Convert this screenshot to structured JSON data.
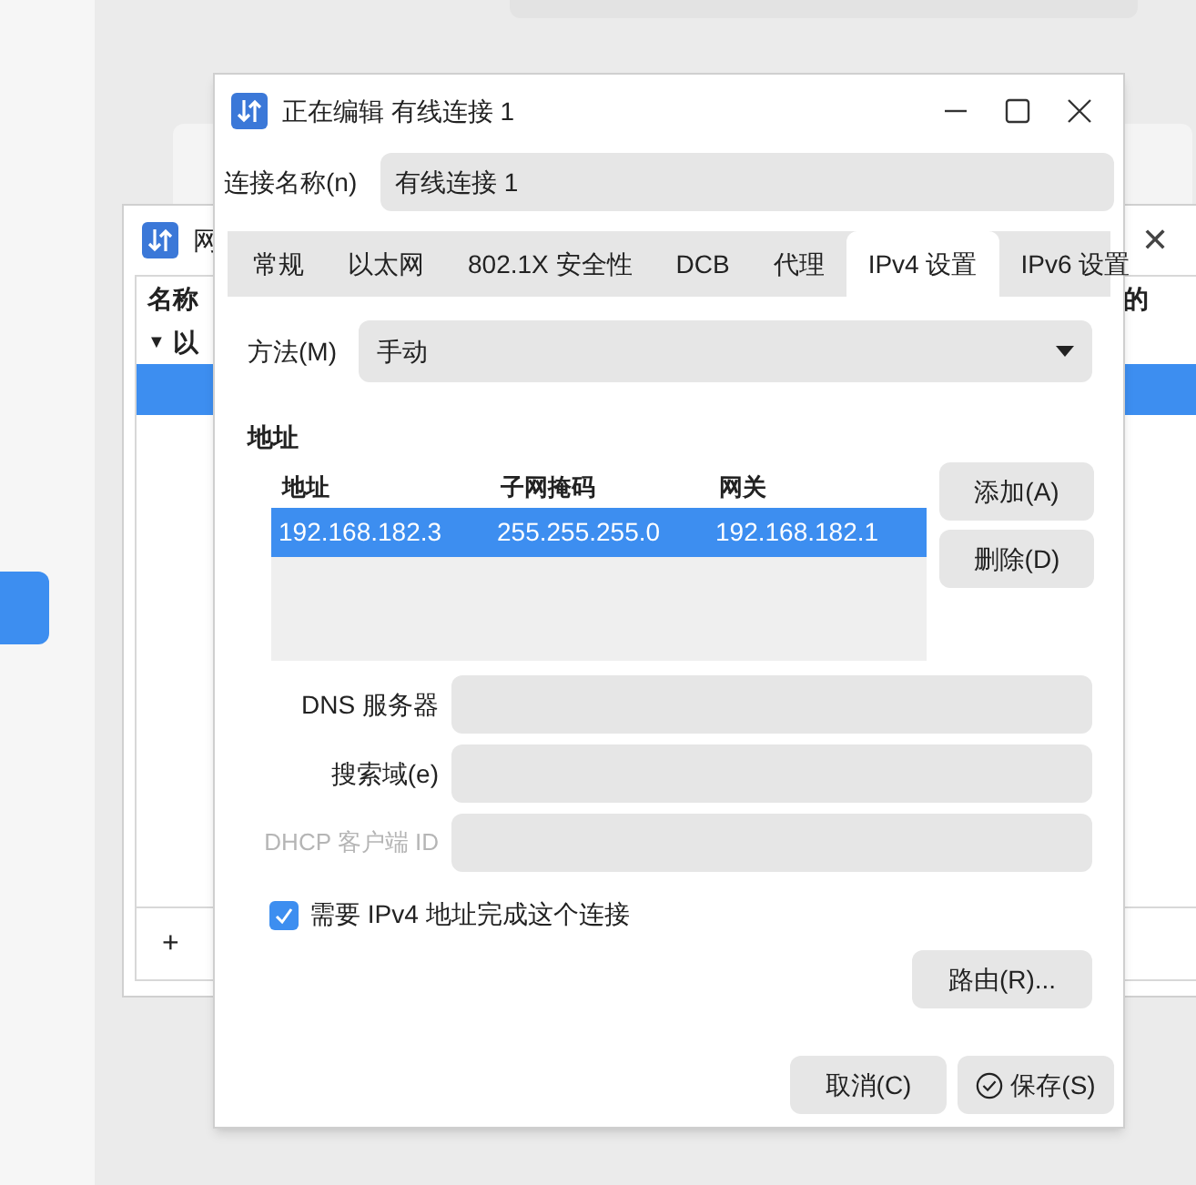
{
  "background": {
    "window": {
      "title": "网",
      "close": "✕",
      "columns": [
        "名称",
        "的"
      ],
      "expand": "▼",
      "group": "以",
      "add": "+"
    }
  },
  "dialog": {
    "title": "正在编辑 有线连接 1",
    "name_label": "连接名称(n)",
    "name_value": "有线连接 1",
    "tabs": [
      {
        "label": "常规",
        "selected": false
      },
      {
        "label": "以太网",
        "selected": false
      },
      {
        "label": "802.1X 安全性",
        "selected": false
      },
      {
        "label": "DCB",
        "selected": false
      },
      {
        "label": "代理",
        "selected": false
      },
      {
        "label": "IPv4 设置",
        "selected": true
      },
      {
        "label": "IPv6 设置",
        "selected": false
      }
    ],
    "method_label": "方法(M)",
    "method_value": "手动",
    "address_heading": "地址",
    "address_table": {
      "columns": [
        "地址",
        "子网掩码",
        "网关"
      ],
      "rows": [
        {
          "cells": [
            "192.168.182.3",
            "255.255.255.0",
            "192.168.182.1"
          ],
          "selected": true
        }
      ]
    },
    "table_buttons": [
      "添加(A)",
      "删除(D)"
    ],
    "fields": [
      {
        "label": "DNS 服务器",
        "disabled": false
      },
      {
        "label": "搜索域(e)",
        "disabled": false
      },
      {
        "label": "DHCP 客户端 ID",
        "disabled": true
      }
    ],
    "require_ipv4": {
      "label": "需要 IPv4 地址完成这个连接",
      "checked": true
    },
    "routes_button": "路由(R)...",
    "buttons": [
      {
        "label": "取消(C)",
        "kind": "plain"
      },
      {
        "label": "保存(S)",
        "kind": "save"
      }
    ]
  }
}
